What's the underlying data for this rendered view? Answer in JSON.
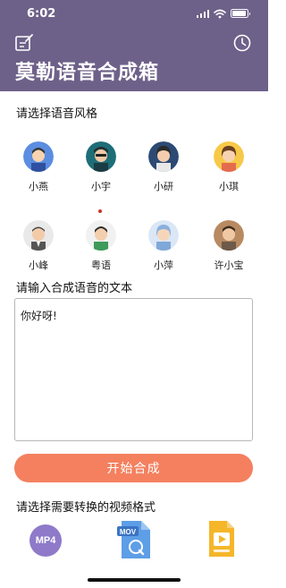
{
  "status_bar": {
    "time": "6:02"
  },
  "header": {
    "title": "莫勒语音合成箱",
    "left_icon": "edit-icon",
    "right_icon": "history-clock-icon"
  },
  "voice_section": {
    "label": "请选择语音风格",
    "voices": [
      {
        "name": "小燕",
        "icon": "avatar-boy-blue"
      },
      {
        "name": "小宇",
        "icon": "avatar-man-teal"
      },
      {
        "name": "小研",
        "icon": "avatar-woman-navy"
      },
      {
        "name": "小琪",
        "icon": "avatar-girl-yellow"
      },
      {
        "name": "小峰",
        "icon": "avatar-man-suit"
      },
      {
        "name": "粤语",
        "icon": "avatar-boy-green",
        "selected": true
      },
      {
        "name": "小萍",
        "icon": "avatar-woman-blue"
      },
      {
        "name": "许小宝",
        "icon": "avatar-man-brown"
      }
    ]
  },
  "text_section": {
    "label": "请输入合成语音的文本",
    "value": "你好呀!"
  },
  "start_button": {
    "label": "开始合成"
  },
  "format_section": {
    "label": "请选择需要转换的视频格式",
    "formats": [
      {
        "label": "MP4",
        "icon": "mp4-icon"
      },
      {
        "label": "MOV",
        "icon": "mov-file-icon"
      },
      {
        "label": "",
        "icon": "video-file-icon"
      }
    ]
  },
  "colors": {
    "header_bg": "#6e6189",
    "button_bg": "#f4805f",
    "mp4_badge": "#8e7ac9",
    "mov_file": "#4a90d9",
    "video_file": "#f5b62a"
  }
}
